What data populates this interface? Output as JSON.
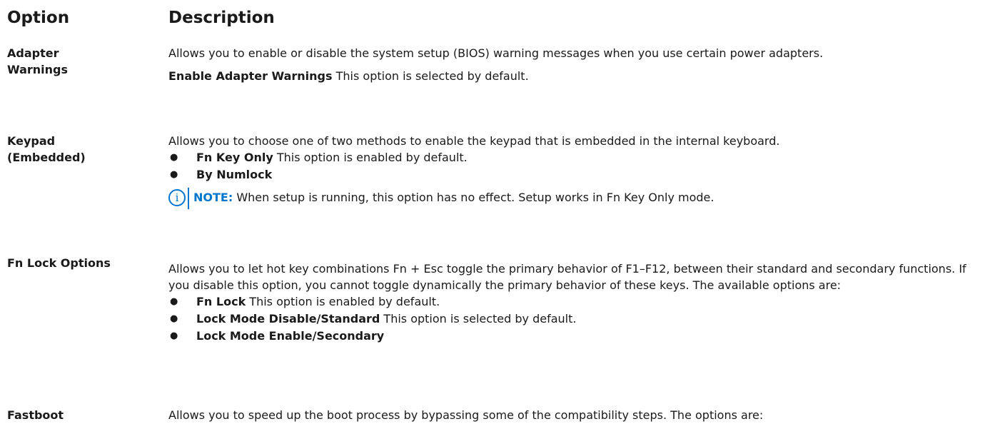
{
  "table": {
    "headers": {
      "option": "Option",
      "description": "Description"
    },
    "rows": [
      {
        "option": "Adapter Warnings",
        "option_lines": [
          "Adapter",
          "Warnings"
        ],
        "paragraphs": [
          "Allows you to enable or disable the system setup (BIOS) warning messages when you use certain power adapters."
        ],
        "setting": {
          "label": "Enable Adapter Warnings",
          "text": " This option is selected by default."
        }
      },
      {
        "option": "Keypad (Embedded)",
        "option_lines": [
          "Keypad",
          "(Embedded)"
        ],
        "paragraphs": [
          "Allows you to choose one of two methods to enable the keypad that is embedded in the internal keyboard."
        ],
        "bullets": [
          {
            "label": "Fn Key Only",
            "text": " This option is enabled by default."
          },
          {
            "label": "By Numlock",
            "text": ""
          }
        ],
        "note": {
          "icon": "info-icon",
          "label": "NOTE:",
          "text": " When setup is running, this option has no effect. Setup works in Fn Key Only mode."
        }
      },
      {
        "option": "Fn Lock Options",
        "paragraphs": [
          "Allows you to let hot key combinations Fn + Esc toggle the primary behavior of F1–F12, between their standard and secondary functions. If you disable this option, you cannot toggle dynamically the primary behavior of these keys. The available options are:"
        ],
        "bullets": [
          {
            "label": "Fn Lock",
            "text": " This option is enabled by default."
          },
          {
            "label": "Lock Mode Disable/Standard",
            "text": " This option is selected by default."
          },
          {
            "label": "Lock Mode Enable/Secondary",
            "text": ""
          }
        ]
      },
      {
        "option": "Fastboot",
        "paragraphs": [
          "Allows you to speed up the boot process by bypassing some of the compatibility steps. The options are:"
        ]
      }
    ]
  },
  "bullet_glyph": "●",
  "colors": {
    "text": "#1a1a1a",
    "note_accent": "#0076ce"
  },
  "icons": {
    "note": "info-icon"
  },
  "note_icon_glyph": "i"
}
